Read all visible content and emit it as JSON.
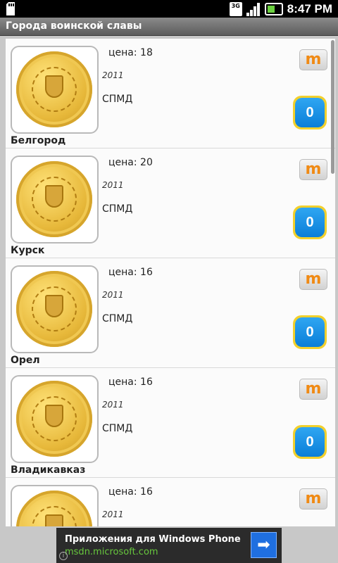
{
  "status_bar": {
    "time": "8:47 PM",
    "network": "3G"
  },
  "title": "Города воинской славы",
  "items": [
    {
      "city": "Белгород",
      "price": "цена: 18",
      "year": "2011",
      "mint": "СПМД",
      "count": "0"
    },
    {
      "city": "Курск",
      "price": "цена: 20",
      "year": "2011",
      "mint": "СПМД",
      "count": "0"
    },
    {
      "city": "Орел",
      "price": "цена: 16",
      "year": "2011",
      "mint": "СПМД",
      "count": "0"
    },
    {
      "city": "Владикавказ",
      "price": "цена: 16",
      "year": "2011",
      "mint": "СПМД",
      "count": "0"
    },
    {
      "city": "",
      "price": "цена: 16",
      "year": "2011",
      "mint": "",
      "count": ""
    }
  ],
  "item_button_label": "m",
  "ad": {
    "title": "Приложения для Windows Phone",
    "url": "msdn.microsoft.com",
    "info": "i",
    "arrow": "➡"
  }
}
